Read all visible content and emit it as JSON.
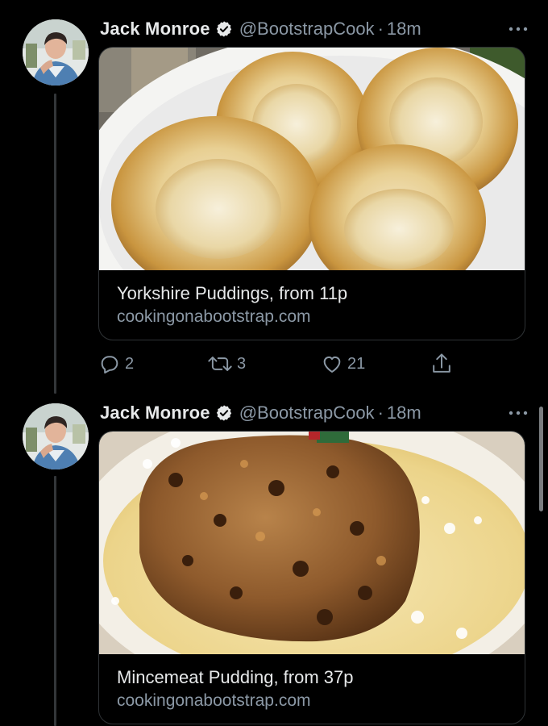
{
  "tweets": [
    {
      "author": {
        "name": "Jack Monroe",
        "handle": "@BootstrapCook",
        "time": "18m"
      },
      "card": {
        "title": "Yorkshire Puddings, from 11p",
        "domain": "cookingonabootstrap.com"
      },
      "actions": {
        "reply_count": "2",
        "retweet_count": "3",
        "like_count": "21"
      }
    },
    {
      "author": {
        "name": "Jack Monroe",
        "handle": "@BootstrapCook",
        "time": "18m"
      },
      "card": {
        "title": "Mincemeat Pudding, from 37p",
        "domain": "cookingonabootstrap.com"
      }
    }
  ],
  "separator": "·",
  "icons": {
    "verified": "verified-badge-icon",
    "more": "more-options-icon",
    "reply": "reply-icon",
    "retweet": "retweet-icon",
    "like": "heart-icon",
    "share": "share-icon"
  },
  "colors": {
    "background": "#000000",
    "primary_text": "#e7e9ea",
    "secondary_text": "#8b98a5",
    "border": "#2f3336"
  }
}
